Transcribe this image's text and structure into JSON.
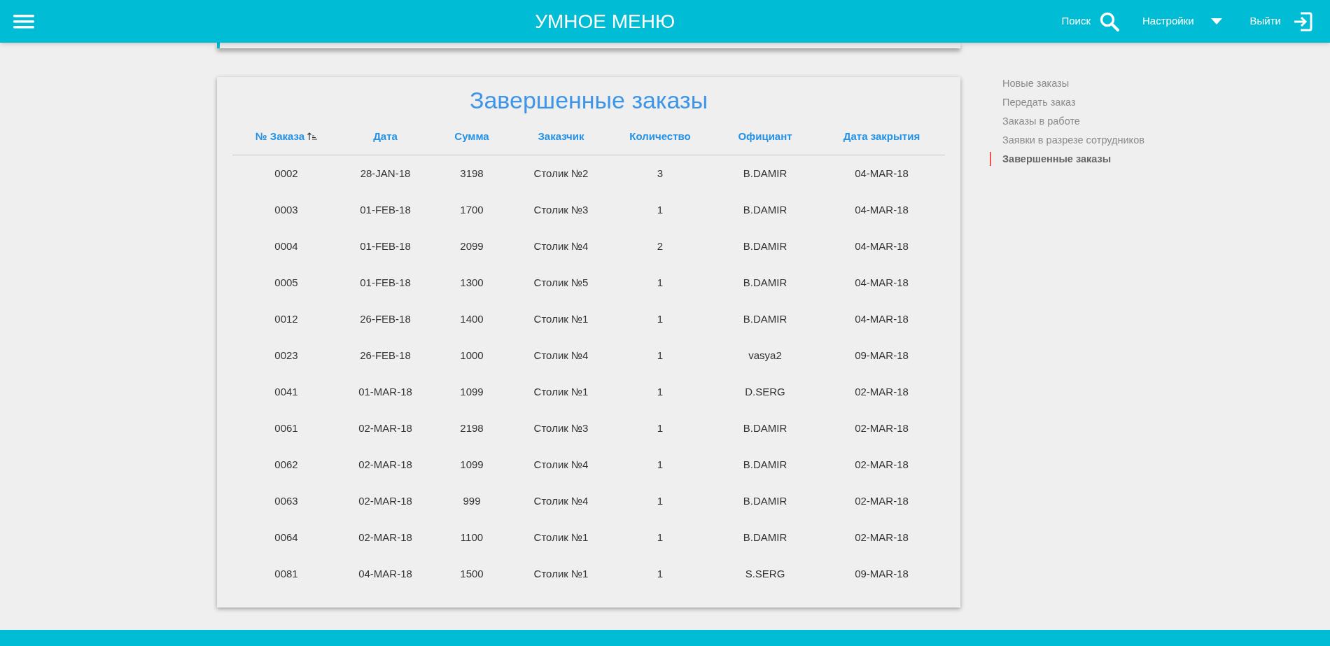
{
  "header": {
    "title": "УМНОЕ МЕНЮ",
    "search_label": "Поиск",
    "settings_label": "Настройки",
    "logout_label": "Выйти"
  },
  "orders": {
    "title": "Завершенные заказы",
    "columns": [
      {
        "label": "№ Заказа",
        "sorted": true
      },
      {
        "label": "Дата",
        "sorted": false
      },
      {
        "label": "Сумма",
        "sorted": false
      },
      {
        "label": "Заказчик",
        "sorted": false
      },
      {
        "label": "Количество",
        "sorted": false
      },
      {
        "label": "Официант",
        "sorted": false
      },
      {
        "label": "Дата закрытия",
        "sorted": false
      }
    ],
    "rows": [
      [
        "0002",
        "28-JAN-18",
        "3198",
        "Столик №2",
        "3",
        "B.DAMIR",
        "04-MAR-18"
      ],
      [
        "0003",
        "01-FEB-18",
        "1700",
        "Столик №3",
        "1",
        "B.DAMIR",
        "04-MAR-18"
      ],
      [
        "0004",
        "01-FEB-18",
        "2099",
        "Столик №4",
        "2",
        "B.DAMIR",
        "04-MAR-18"
      ],
      [
        "0005",
        "01-FEB-18",
        "1300",
        "Столик №5",
        "1",
        "B.DAMIR",
        "04-MAR-18"
      ],
      [
        "0012",
        "26-FEB-18",
        "1400",
        "Столик №1",
        "1",
        "B.DAMIR",
        "04-MAR-18"
      ],
      [
        "0023",
        "26-FEB-18",
        "1000",
        "Столик №4",
        "1",
        "vasya2",
        "09-MAR-18"
      ],
      [
        "0041",
        "01-MAR-18",
        "1099",
        "Столик №1",
        "1",
        "D.SERG",
        "02-MAR-18"
      ],
      [
        "0061",
        "02-MAR-18",
        "2198",
        "Столик №3",
        "1",
        "B.DAMIR",
        "02-MAR-18"
      ],
      [
        "0062",
        "02-MAR-18",
        "1099",
        "Столик №4",
        "1",
        "B.DAMIR",
        "02-MAR-18"
      ],
      [
        "0063",
        "02-MAR-18",
        "999",
        "Столик №4",
        "1",
        "B.DAMIR",
        "02-MAR-18"
      ],
      [
        "0064",
        "02-MAR-18",
        "1100",
        "Столик №1",
        "1",
        "B.DAMIR",
        "02-MAR-18"
      ],
      [
        "0081",
        "04-MAR-18",
        "1500",
        "Столик №1",
        "1",
        "S.SERG",
        "09-MAR-18"
      ]
    ]
  },
  "nav": [
    {
      "label": "Новые заказы",
      "selected": false
    },
    {
      "label": "Передать заказ",
      "selected": false
    },
    {
      "label": "Заказы в работе",
      "selected": false
    },
    {
      "label": "Заявки в разрезе сотрудников",
      "selected": false
    },
    {
      "label": "Завершенные заказы",
      "selected": true
    }
  ]
}
